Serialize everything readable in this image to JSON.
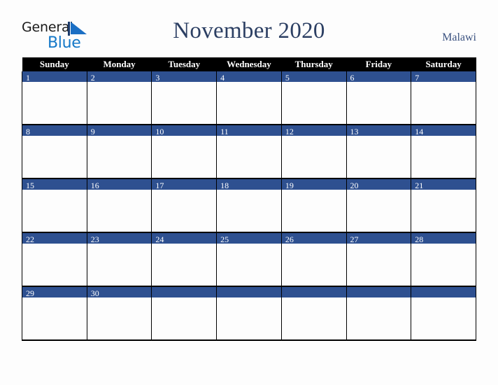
{
  "brand": {
    "name_part1": "General",
    "name_part2": "Blue",
    "triangle_icon": "triangle-icon",
    "accent_dark": "#1a1a1a",
    "accent_blue": "#1478c8"
  },
  "header": {
    "title": "November 2020",
    "locale": "Malawi",
    "title_color": "#2c3f63",
    "locale_color": "#3b5280"
  },
  "calendar": {
    "month": "November",
    "year": "2020",
    "weekday_headers": [
      "Sunday",
      "Monday",
      "Tuesday",
      "Wednesday",
      "Thursday",
      "Friday",
      "Saturday"
    ],
    "header_bg": "#000000",
    "header_text": "#ffffff",
    "date_bar_bg": "#2e5090",
    "date_text": "#ffffff",
    "cell_bg": "#fdfdfd",
    "grid_line": "#000000",
    "weeks": [
      [
        {
          "date": "1"
        },
        {
          "date": "2"
        },
        {
          "date": "3"
        },
        {
          "date": "4"
        },
        {
          "date": "5"
        },
        {
          "date": "6"
        },
        {
          "date": "7"
        }
      ],
      [
        {
          "date": "8"
        },
        {
          "date": "9"
        },
        {
          "date": "10"
        },
        {
          "date": "11"
        },
        {
          "date": "12"
        },
        {
          "date": "13"
        },
        {
          "date": "14"
        }
      ],
      [
        {
          "date": "15"
        },
        {
          "date": "16"
        },
        {
          "date": "17"
        },
        {
          "date": "18"
        },
        {
          "date": "19"
        },
        {
          "date": "20"
        },
        {
          "date": "21"
        }
      ],
      [
        {
          "date": "22"
        },
        {
          "date": "23"
        },
        {
          "date": "24"
        },
        {
          "date": "25"
        },
        {
          "date": "26"
        },
        {
          "date": "27"
        },
        {
          "date": "28"
        }
      ],
      [
        {
          "date": "29"
        },
        {
          "date": "30"
        },
        {
          "date": ""
        },
        {
          "date": ""
        },
        {
          "date": ""
        },
        {
          "date": ""
        },
        {
          "date": ""
        }
      ]
    ]
  }
}
